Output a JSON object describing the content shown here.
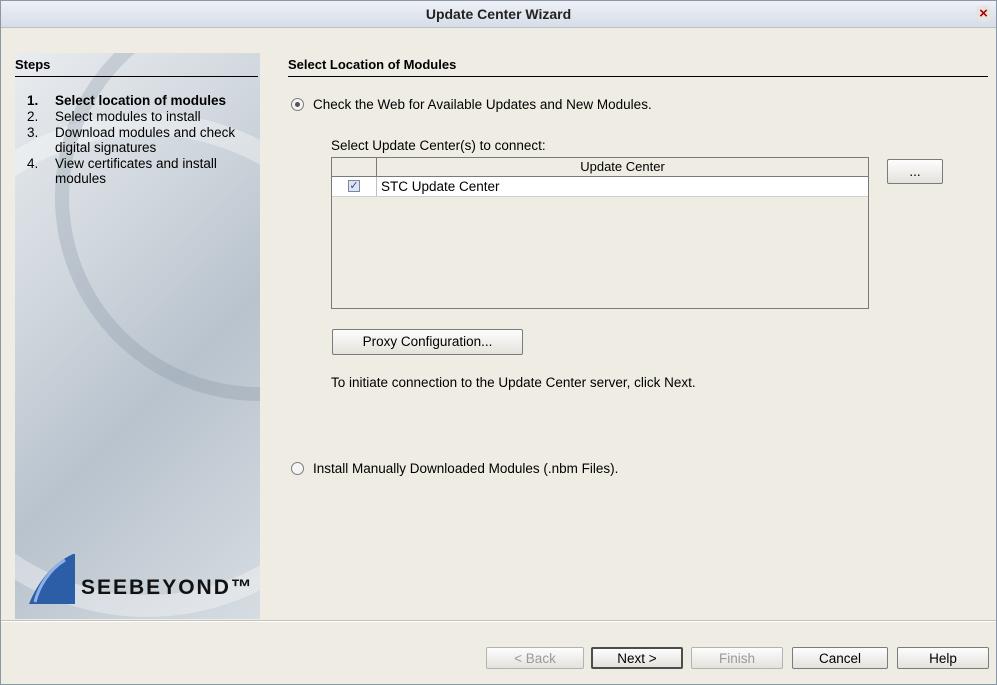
{
  "window": {
    "title": "Update Center Wizard"
  },
  "steps": {
    "header": "Steps",
    "items": [
      {
        "num": "1.",
        "label": "Select location of modules"
      },
      {
        "num": "2.",
        "label": "Select modules to install"
      },
      {
        "num": "3.",
        "label": "Download modules and check digital signatures"
      },
      {
        "num": "4.",
        "label": "View certificates and install modules"
      }
    ],
    "logo_text": "SEEBEYOND™"
  },
  "main": {
    "header": "Select Location of Modules",
    "option_web": "Check the Web for Available Updates and New Modules.",
    "select_label": "Select Update Center(s) to connect:",
    "table_header": "Update Center",
    "table_rows": [
      {
        "checked": true,
        "name": "STC Update Center"
      }
    ],
    "browse_button": "...",
    "proxy_button": "Proxy Configuration...",
    "info_text": "To initiate connection to the Update Center server, click Next.",
    "option_manual": "Install Manually Downloaded Modules (.nbm Files)."
  },
  "buttons": {
    "back": "< Back",
    "next": "Next >",
    "finish": "Finish",
    "cancel": "Cancel",
    "help": "Help"
  },
  "colors": {
    "window_bg": "#eeece3",
    "logo_blue": "#2c5ea8"
  }
}
